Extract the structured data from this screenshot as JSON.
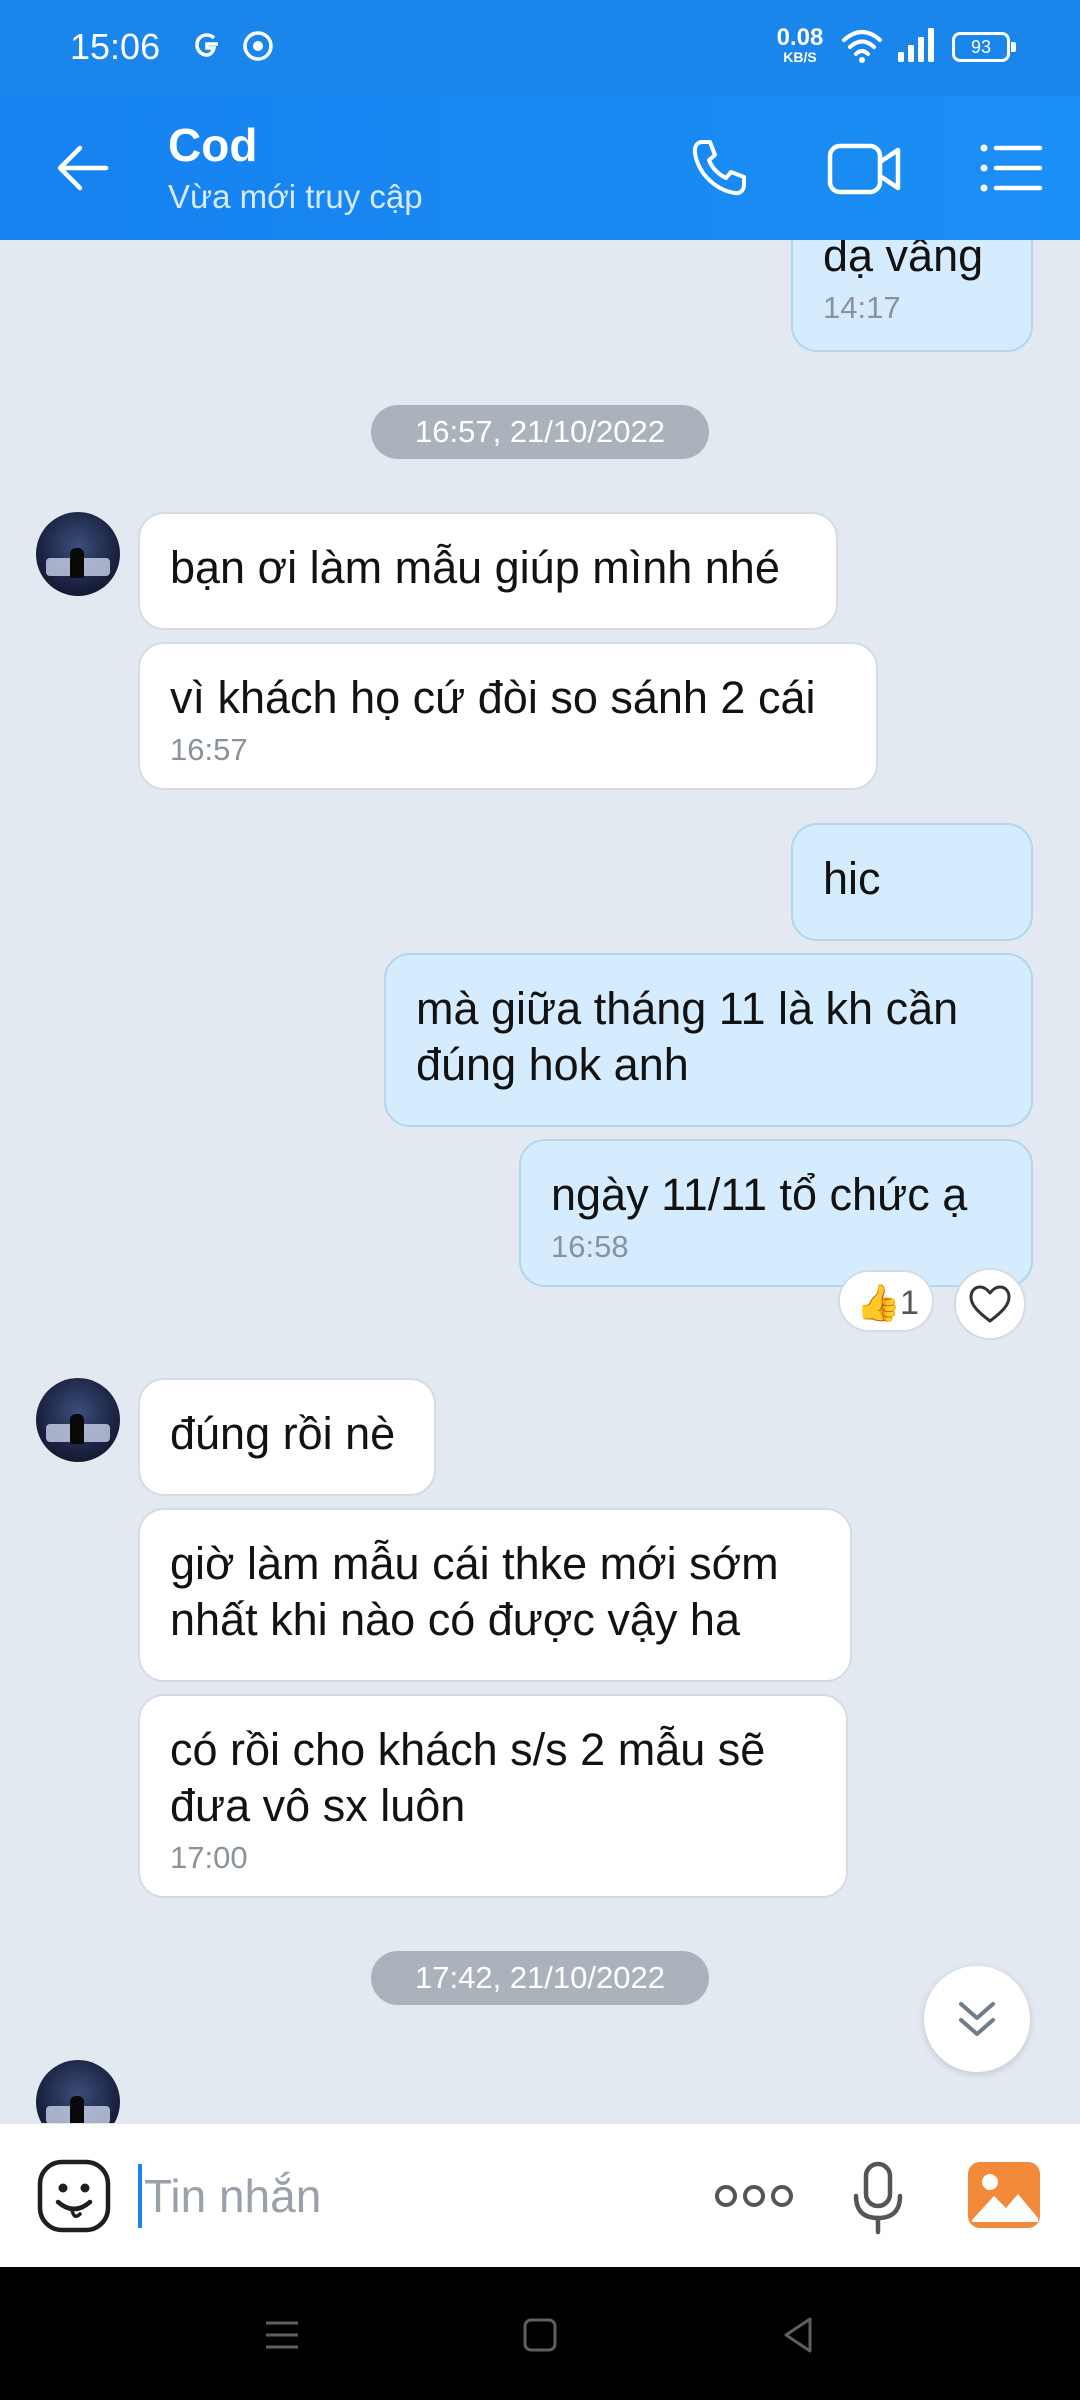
{
  "status_bar": {
    "time": "15:06",
    "net_speed_value": "0.08",
    "net_speed_unit": "KB/S",
    "battery": "93"
  },
  "header": {
    "contact_name": "Cod",
    "contact_status": "Vừa mới truy cập"
  },
  "messages": [
    {
      "dir": "out",
      "text": "dạ vâng",
      "time": "14:17"
    },
    {
      "dir": "in",
      "text": "bạn ơi làm mẫu giúp mình nhé"
    },
    {
      "dir": "in",
      "text": "vì khách họ cứ đòi so sánh 2 cái",
      "time": "16:57"
    },
    {
      "dir": "out",
      "text": "hic"
    },
    {
      "dir": "out",
      "text": "mà giữa tháng 11 là kh cần đúng hok anh"
    },
    {
      "dir": "out",
      "text": "ngày 11/11 tổ chức ạ",
      "time": "16:58"
    },
    {
      "dir": "in",
      "text": "đúng rồi nè"
    },
    {
      "dir": "in",
      "text": "giờ làm mẫu cái thke mới sớm nhất khi nào có được vậy ha"
    },
    {
      "dir": "in",
      "text": "có rồi cho khách s/s 2 mẫu sẽ đưa vô sx luôn",
      "time": "17:00"
    }
  ],
  "date_separators": [
    "16:57, 21/10/2022",
    "17:42, 21/10/2022"
  ],
  "reaction": {
    "emoji": "👍",
    "count": "1"
  },
  "input": {
    "placeholder": "Tin nhắn"
  },
  "colors": {
    "header_blue": "#1a86ec",
    "outgoing_bubble": "#d4ecfd",
    "incoming_bubble": "#ffffff",
    "chat_background": "#e2e9f1"
  },
  "icons": [
    "back-arrow-icon",
    "phone-icon",
    "video-call-icon",
    "menu-list-icon",
    "emoji-icon",
    "more-dots-icon",
    "microphone-icon",
    "gallery-icon",
    "heart-icon",
    "double-chevron-down-icon"
  ]
}
